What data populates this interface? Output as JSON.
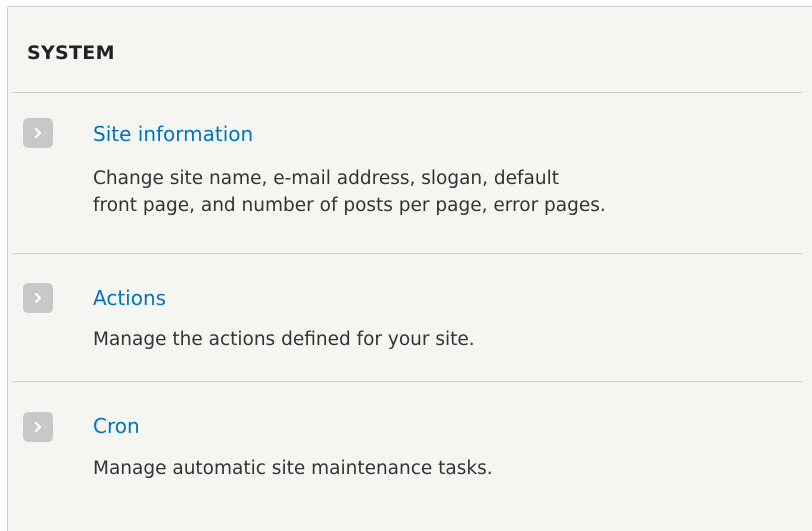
{
  "section": {
    "title": "SYSTEM"
  },
  "items": [
    {
      "title": "Site information",
      "description_lines": [
        "Change site name, e-mail address, slogan, default",
        "front page, and number of posts per page, error pages."
      ],
      "icon": "chevron-right-icon"
    },
    {
      "title": "Actions",
      "description_lines": [
        "Manage the actions defined for your site."
      ],
      "icon": "chevron-right-icon"
    },
    {
      "title": "Cron",
      "description_lines": [
        "Manage automatic site maintenance tasks."
      ],
      "icon": "chevron-right-icon"
    }
  ],
  "colors": {
    "panel_background": "#f5f5f2",
    "link": "#0074bd",
    "icon_background": "#c8c8c8",
    "divider": "#cfcfcf",
    "text": "#333333"
  }
}
